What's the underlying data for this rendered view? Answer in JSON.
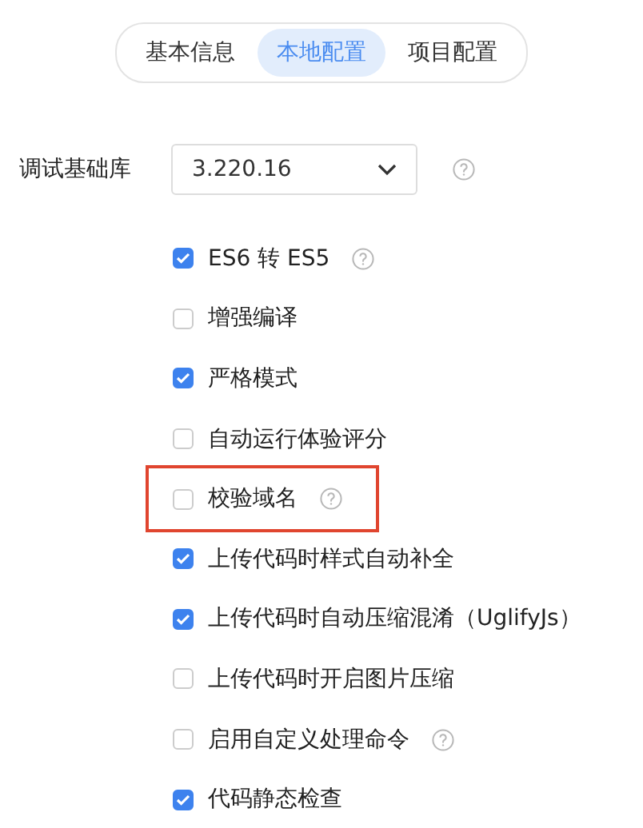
{
  "tabs": [
    {
      "label": "基本信息",
      "selected": false
    },
    {
      "label": "本地配置",
      "selected": true
    },
    {
      "label": "项目配置",
      "selected": false
    }
  ],
  "library": {
    "label": "调试基础库",
    "value": "3.220.16",
    "help": true
  },
  "options": [
    {
      "label": "ES6 转 ES5",
      "checked": true,
      "help": true,
      "highlighted": false
    },
    {
      "label": "增强编译",
      "checked": false,
      "help": false,
      "highlighted": false
    },
    {
      "label": "严格模式",
      "checked": true,
      "help": false,
      "highlighted": false
    },
    {
      "label": "自动运行体验评分",
      "checked": false,
      "help": false,
      "highlighted": false
    },
    {
      "label": "校验域名",
      "checked": false,
      "help": true,
      "highlighted": true
    },
    {
      "label": "上传代码时样式自动补全",
      "checked": true,
      "help": false,
      "highlighted": false
    },
    {
      "label": "上传代码时自动压缩混淆（UglifyJs）",
      "checked": true,
      "help": false,
      "highlighted": false
    },
    {
      "label": "上传代码时开启图片压缩",
      "checked": false,
      "help": false,
      "highlighted": false
    },
    {
      "label": "启用自定义处理命令",
      "checked": false,
      "help": true,
      "highlighted": false
    },
    {
      "label": "代码静态检查",
      "checked": true,
      "help": false,
      "highlighted": false
    }
  ]
}
